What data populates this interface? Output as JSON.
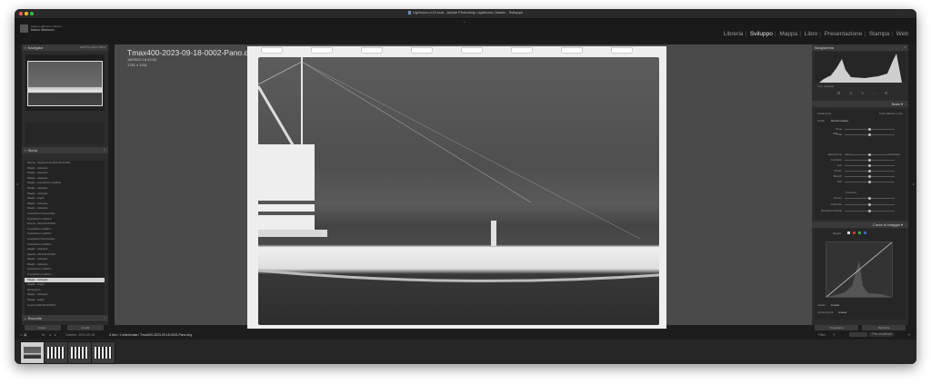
{
  "window": {
    "title": "Lightroom-v13.lrcat - Adobe Photoshop Lightroom Classic - Sviluppo"
  },
  "identity": {
    "line1": "Adobe Lightroom Classic",
    "line2": "Marco Mariuzzo"
  },
  "modules": [
    {
      "label": "Libreria",
      "active": false
    },
    {
      "label": "Sviluppo",
      "active": true
    },
    {
      "label": "Mappa",
      "active": false
    },
    {
      "label": "Libro",
      "active": false
    },
    {
      "label": "Presentazione",
      "active": false
    },
    {
      "label": "Stampa",
      "active": false
    },
    {
      "label": "Web",
      "active": false
    }
  ],
  "left_panel": {
    "navigator": {
      "label": "Navigator",
      "options": "ADATTA  100%  200%"
    },
    "history": {
      "label": "Storia",
      "items": [
        {
          "label": "Esporta - Negativo/Lab 2023-09-18-0002",
          "value": ""
        },
        {
          "label": "Ritaglio - rettangolo",
          "value": ""
        },
        {
          "label": "Ritaglio - rettangolo",
          "value": ""
        },
        {
          "label": "Ritaglio - rettangolo",
          "value": ""
        },
        {
          "label": "Ritaglio - impostazioni modifiche",
          "value": ""
        },
        {
          "label": "Ritaglio - rettangolo",
          "value": ""
        },
        {
          "label": "Ritaglio - rettangolo",
          "value": ""
        },
        {
          "label": "Ritaglio - angolo",
          "value": ""
        },
        {
          "label": "Ritaglio - rettangolo",
          "value": ""
        },
        {
          "label": "Ritaglio - rettangolo",
          "value": ""
        },
        {
          "label": "Impostazioni Camera Raw",
          "value": ""
        },
        {
          "label": "Impostazioni modifiche",
          "value": ""
        },
        {
          "label": "Esporta - 2023-09-18 0002",
          "value": ""
        },
        {
          "label": "Impostazioni modifiche",
          "value": ""
        },
        {
          "label": "Impostazioni modifiche",
          "value": ""
        },
        {
          "label": "Impostazioni Camera Raw",
          "value": ""
        },
        {
          "label": "Impostazioni modifiche",
          "value": ""
        },
        {
          "label": "Ritaglio - rettangolo",
          "value": ""
        },
        {
          "label": "Esporta - 2023-09-18 0002",
          "value": ""
        },
        {
          "label": "Ritaglio - rettangolo",
          "value": ""
        },
        {
          "label": "Ritaglio - rettangolo",
          "value": ""
        },
        {
          "label": "Impostazioni modifiche",
          "value": ""
        },
        {
          "label": "Impostazioni modifiche",
          "value": ""
        },
        {
          "label": "Ritaglio - rettangolo",
          "value": "",
          "selected": true
        },
        {
          "label": "Ritaglio - angolo",
          "value": ""
        },
        {
          "label": "Da Negativo",
          "value": ""
        },
        {
          "label": "Ritaglio - rettangolo",
          "value": ""
        },
        {
          "label": "Ritaglio - angolo",
          "value": ""
        },
        {
          "label": "Importa (2023-09-18 0002)",
          "value": ""
        }
      ]
    },
    "collections": {
      "label": "Raccolte"
    },
    "buttons": {
      "copy": "Copia...",
      "paste": "Incolla"
    }
  },
  "image_info": {
    "filename": "Tmax400-2023-09-18-0002-Pano.dng",
    "datetime": "18/09/23 18:42:53",
    "dimensions": "1781 x 1201"
  },
  "right_panel": {
    "histogram": {
      "label": "Istogramma",
      "original_photo": "Foto originale"
    },
    "basic": {
      "label": "Base",
      "treatment_label": "Trattamento:",
      "treatment_value": "Colore  Bianco e nero",
      "profile_label": "Profilo",
      "profile_value": "Monocromatico",
      "wb_label": "WB",
      "tone_label": "Tono",
      "auto_label": "Automatica",
      "sliders": [
        "Temp",
        "Tinta",
        "Esposizione",
        "Contrasto",
        "Luci",
        "Ombre",
        "Bianchi",
        "Neri"
      ],
      "presence_label": "Presenza",
      "presence_sliders": [
        "Texture",
        "Chiarezza",
        "Rimozione foschia"
      ]
    },
    "tone_curve": {
      "label": "Curva di viraggio",
      "adjust_label": "Regola:",
      "channel_label": "Canale:",
      "channel_value": "Lineare",
      "points_label": "Curva di punti:",
      "points_value": "Lineare"
    },
    "buttons": {
      "previous": "Precedente",
      "reset": "Ripristina"
    }
  },
  "toolbar": {
    "folder_label": "Cartella : 2023-09-18",
    "filter_label": "4 foto / 1 selezionata / Tmax400-2023-09-18-0002-Pano.dng",
    "filter": "Filtro :",
    "filter_value": "Filtri disattivati"
  },
  "filmstrip": {
    "thumbs": [
      {
        "name": "thumb-1",
        "selected": true
      },
      {
        "name": "thumb-2",
        "selected": false
      },
      {
        "name": "thumb-3",
        "selected": false
      },
      {
        "name": "thumb-4",
        "selected": false
      }
    ]
  }
}
